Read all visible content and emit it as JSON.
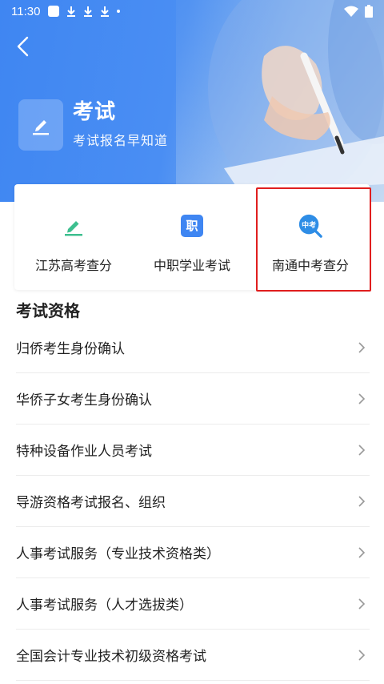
{
  "status_bar": {
    "time": "11:30"
  },
  "header": {
    "title": "考试",
    "subtitle": "考试报名早知道"
  },
  "quick_entries": [
    {
      "label": "江苏高考查分",
      "icon": "pencil-icon",
      "color": "#3dbf8f"
    },
    {
      "label": "中职学业考试",
      "icon": "zhi-badge-icon",
      "badge_text": "职",
      "color": "#3f86f2"
    },
    {
      "label": "南通中考查分",
      "icon": "zhongkao-search-icon",
      "badge_text": "中考",
      "color": "#2e8de6",
      "highlighted": true
    }
  ],
  "section": {
    "title": "考试资格"
  },
  "list_items": [
    {
      "label": "归侨考生身份确认"
    },
    {
      "label": "华侨子女考生身份确认"
    },
    {
      "label": "特种设备作业人员考试"
    },
    {
      "label": "导游资格考试报名、组织"
    },
    {
      "label": "人事考试服务（专业技术资格类）"
    },
    {
      "label": "人事考试服务（人才选拔类）"
    },
    {
      "label": "全国会计专业技术初级资格考试"
    }
  ],
  "colors": {
    "accent": "#3f86f2",
    "highlight_border": "#e01e1e"
  }
}
